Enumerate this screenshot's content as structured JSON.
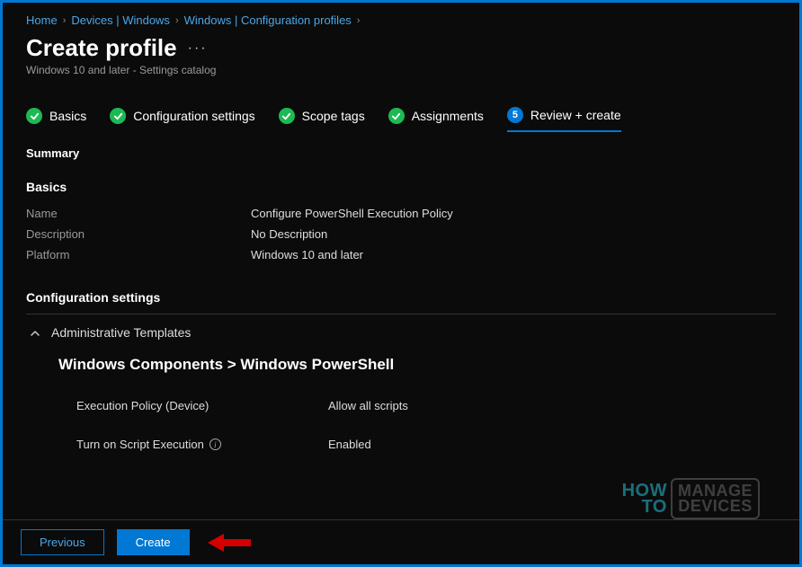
{
  "breadcrumb": {
    "items": [
      {
        "label": "Home"
      },
      {
        "label": "Devices | Windows"
      },
      {
        "label": "Windows | Configuration profiles"
      }
    ]
  },
  "page": {
    "title": "Create profile",
    "subtitle": "Windows 10 and later - Settings catalog"
  },
  "steps": {
    "items": [
      {
        "label": "Basics",
        "state": "done"
      },
      {
        "label": "Configuration settings",
        "state": "done"
      },
      {
        "label": "Scope tags",
        "state": "done"
      },
      {
        "label": "Assignments",
        "state": "done"
      },
      {
        "label": "Review + create",
        "state": "current",
        "number": "5"
      }
    ]
  },
  "summary_label": "Summary",
  "basics": {
    "heading": "Basics",
    "rows": [
      {
        "key": "Name",
        "value": "Configure PowerShell Execution Policy"
      },
      {
        "key": "Description",
        "value": "No Description"
      },
      {
        "key": "Platform",
        "value": "Windows 10 and later"
      }
    ]
  },
  "config": {
    "heading": "Configuration settings",
    "group_label": "Administrative Templates",
    "path_title": "Windows Components > Windows PowerShell",
    "settings": [
      {
        "label": "Execution Policy (Device)",
        "value": "Allow all scripts",
        "has_info": false
      },
      {
        "label": "Turn on Script Execution",
        "value": "Enabled",
        "has_info": true
      }
    ]
  },
  "footer": {
    "previous_label": "Previous",
    "create_label": "Create"
  },
  "watermark": {
    "line1": "HOW",
    "line2": "TO",
    "box_line1": "MANAGE",
    "box_line2": "DEVICES"
  },
  "colors": {
    "accent": "#0078d4",
    "success": "#1db954",
    "link": "#4ca6e6"
  }
}
